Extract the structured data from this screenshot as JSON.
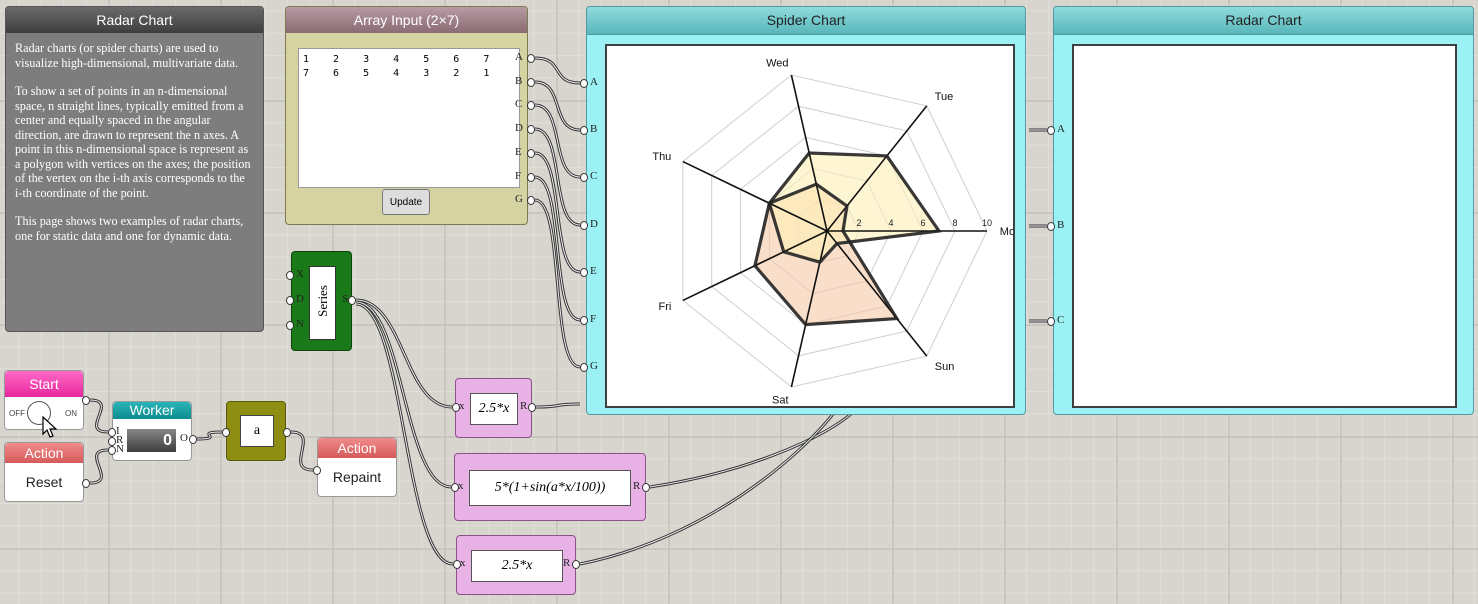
{
  "info": {
    "title": "Radar Chart",
    "paragraphs": [
      "Radar charts (or spider charts) are used to visualize high-dimensional, multivariate data.",
      "To show a set of points in an n-dimensional space, n straight lines, typically emitted from a center and equally spaced in the angular direction, are drawn to represent the n axes. A point in this n-dimensional space is represent as a polygon with vertices on the axes; the position of the vertex on the i-th axis corresponds to the i-th coordinate of the point.",
      "This page shows two examples of radar charts, one for static data and one for dynamic data."
    ]
  },
  "array_input": {
    "title": "Array Input (2×7)",
    "value": "1  2  3  4  5  6  7\n7  6  5  4  3  2  1",
    "update_label": "Update",
    "ports": [
      "A",
      "B",
      "C",
      "D",
      "E",
      "F",
      "G"
    ]
  },
  "series": {
    "label": "Series",
    "inputs": [
      "X",
      "D",
      "N"
    ],
    "output": "S"
  },
  "start": {
    "title": "Start",
    "off": "OFF",
    "on": "ON"
  },
  "action1": {
    "title": "Action",
    "button": "Reset"
  },
  "worker": {
    "title": "Worker",
    "value": "0",
    "inputs": [
      "I",
      "R",
      "N"
    ],
    "output": "O"
  },
  "var": {
    "label": "a"
  },
  "action2": {
    "title": "Action",
    "button": "Repaint"
  },
  "expressions": [
    {
      "formula": "2.5*x",
      "input": "x",
      "output": "R"
    },
    {
      "formula": "5*(1+sin(a*x/100))",
      "input": "x",
      "output": "R"
    },
    {
      "formula": "2.5*x",
      "input": "x",
      "output": "R"
    }
  ],
  "spider": {
    "title": "Spider Chart",
    "ports": [
      "A",
      "B",
      "C",
      "D",
      "E",
      "F",
      "G"
    ]
  },
  "radar": {
    "title": "Radar Chart",
    "ports": [
      "A",
      "B",
      "C"
    ]
  },
  "chart_data": {
    "type": "radar",
    "categories": [
      "Mon",
      "Tue",
      "Wed",
      "Thu",
      "Fri",
      "Sat",
      "Sun"
    ],
    "rmax": 10,
    "ticks": [
      2,
      4,
      6,
      8,
      10
    ],
    "series": [
      {
        "values": [
          1,
          2,
          3,
          4,
          5,
          6,
          7
        ],
        "fill": "#f5c9a6",
        "stroke": "#222222"
      },
      {
        "values": [
          7,
          6,
          5,
          4,
          3,
          2,
          1
        ],
        "fill": "#fdf0b6",
        "stroke": "#222222"
      }
    ],
    "grid": true
  }
}
